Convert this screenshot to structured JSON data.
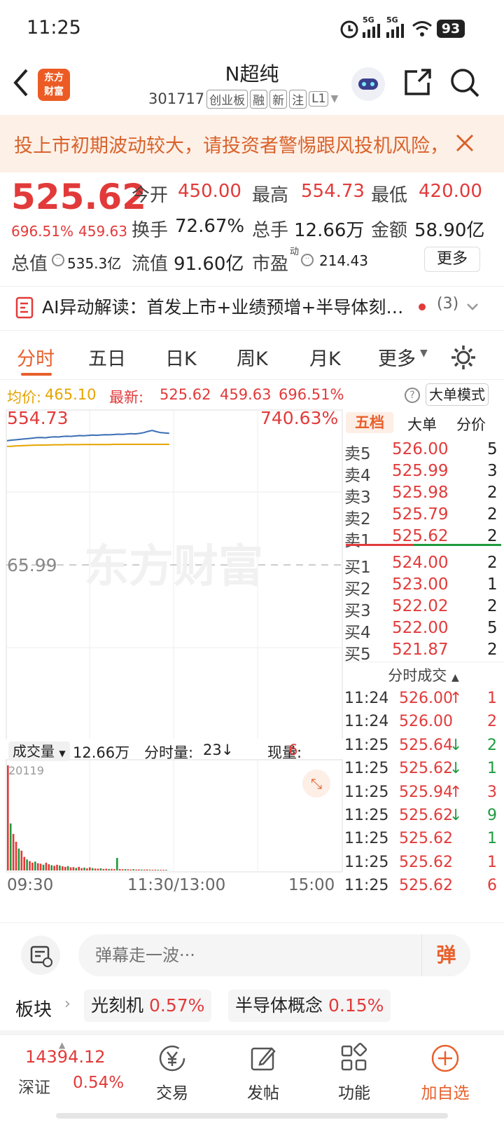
{
  "status": {
    "time": "11:25",
    "net1": "5G",
    "net2": "5G",
    "battery": "93"
  },
  "header": {
    "stock_name": "N超纯",
    "code": "301717",
    "tags": [
      "创业板",
      "融",
      "新",
      "注",
      "L1"
    ],
    "logo_line1": "东方",
    "logo_line2": "财富"
  },
  "warning": {
    "text": "投上市初期波动较大，请投资者警惕跟风投机风险，"
  },
  "quote": {
    "price": "525.62",
    "change_pct": "696.51%",
    "change": "459.63",
    "open_label": "今开",
    "open": "450.00",
    "high_label": "最高",
    "high": "554.73",
    "low_label": "最低",
    "low": "420.00",
    "turnover_label": "换手",
    "turnover": "72.67%",
    "volume_label": "总手",
    "volume": "12.66万",
    "amount_label": "金额",
    "amount": "58.90亿",
    "mcap_label": "总值",
    "mcap": "535.3亿",
    "float_label": "流值",
    "float": "91.60亿",
    "pe_label": "市盈",
    "pe_sup": "动",
    "pe": "214.43",
    "more_label": "更多"
  },
  "ai": {
    "text": "AI异动解读：首发上市+业绩预增+半导体刻…",
    "count": "(3)"
  },
  "tabs": [
    "分时",
    "五日",
    "日K",
    "周K",
    "月K",
    "更多"
  ],
  "pricebar": {
    "avg_label": "均价:",
    "avg": "465.10",
    "latest_label": "最新:",
    "latest": "525.62",
    "change": "459.63",
    "pct": "696.51%",
    "mode_label": "大单模式"
  },
  "chart_data": {
    "type": "line",
    "high_label": "554.73",
    "high_pct": "740.63%",
    "mid_label": "65.99",
    "watermark": "东方财富",
    "x_ticks": [
      "09:30",
      "11:30/13:00",
      "15:00"
    ],
    "price_series": [
      488,
      492,
      494,
      497,
      500,
      502,
      505,
      508,
      509,
      507,
      511,
      513,
      512,
      515,
      517,
      516,
      519,
      521,
      520,
      522,
      524,
      523,
      525,
      527,
      526,
      528,
      530,
      529,
      531,
      533,
      532,
      535,
      540,
      548,
      554,
      546,
      540,
      538,
      536
    ],
    "avg_series": [
      452,
      453,
      455,
      456,
      457,
      458,
      459,
      460,
      460,
      461,
      461,
      462,
      462,
      462,
      463,
      463,
      463,
      463,
      464,
      464,
      464,
      464,
      464,
      464,
      464,
      465,
      465,
      465,
      465,
      465,
      465,
      465,
      465,
      465,
      465,
      465,
      465,
      465,
      465
    ],
    "volume_label": "成交量",
    "volume_total": "12.66万",
    "minute_vol_label": "分时量:",
    "minute_vol": "23",
    "cur_vol_label": "现量:",
    "cur_vol": "6",
    "volume_max": "20119",
    "volume_bars": [
      20119,
      9000,
      7000,
      5500,
      4200,
      3800,
      2600,
      2100,
      1800,
      1500,
      1700,
      1400,
      1300,
      1100,
      1500,
      1200,
      1000,
      900,
      1100,
      950,
      800,
      700,
      850,
      600,
      650,
      500,
      700,
      450,
      550,
      400,
      600,
      450,
      380,
      350,
      420,
      300,
      330,
      280,
      310,
      260,
      2400,
      280,
      230,
      250,
      210,
      190,
      240,
      180,
      200,
      170,
      160,
      190,
      150,
      140,
      160,
      130,
      120,
      110,
      100
    ]
  },
  "orderbook": {
    "tabs": [
      "五档",
      "大单",
      "分价"
    ],
    "asks": [
      {
        "label": "卖5",
        "price": "526.00",
        "vol": "5"
      },
      {
        "label": "卖4",
        "price": "525.99",
        "vol": "3"
      },
      {
        "label": "卖3",
        "price": "525.98",
        "vol": "2"
      },
      {
        "label": "卖2",
        "price": "525.79",
        "vol": "2"
      },
      {
        "label": "卖1",
        "price": "525.62",
        "vol": "2"
      }
    ],
    "bids": [
      {
        "label": "买1",
        "price": "524.00",
        "vol": "2"
      },
      {
        "label": "买2",
        "price": "523.00",
        "vol": "1"
      },
      {
        "label": "买3",
        "price": "522.02",
        "vol": "2"
      },
      {
        "label": "买4",
        "price": "522.00",
        "vol": "5"
      },
      {
        "label": "买5",
        "price": "521.87",
        "vol": "2"
      }
    ],
    "ticks_title": "分时成交",
    "ticks": [
      {
        "time": "11:24",
        "price": "526.00",
        "dir": "↑",
        "vol": "1",
        "color": "red"
      },
      {
        "time": "11:24",
        "price": "526.00",
        "dir": "",
        "vol": "2",
        "color": "red"
      },
      {
        "time": "11:25",
        "price": "525.64",
        "dir": "↓",
        "vol": "2",
        "color": "green"
      },
      {
        "time": "11:25",
        "price": "525.62",
        "dir": "↓",
        "vol": "1",
        "color": "green"
      },
      {
        "time": "11:25",
        "price": "525.94",
        "dir": "↑",
        "vol": "3",
        "color": "red"
      },
      {
        "time": "11:25",
        "price": "525.62",
        "dir": "↓",
        "vol": "9",
        "color": "green"
      },
      {
        "time": "11:25",
        "price": "525.62",
        "dir": "",
        "vol": "1",
        "color": "green"
      },
      {
        "time": "11:25",
        "price": "525.62",
        "dir": "",
        "vol": "1",
        "color": "red"
      },
      {
        "time": "11:25",
        "price": "525.62",
        "dir": "",
        "vol": "6",
        "color": "red"
      }
    ]
  },
  "comment": {
    "placeholder": "弹幕走一波···",
    "send_label": "弹"
  },
  "sector": {
    "label": "板块",
    "items": [
      {
        "name": "光刻机",
        "pct": "0.57%"
      },
      {
        "name": "半导体概念",
        "pct": "0.15%"
      }
    ]
  },
  "bottomnav": {
    "index_value": "14394.12",
    "index_name": "深证",
    "index_pct": "0.54%",
    "items": [
      {
        "label": "交易",
        "icon": "yen-icon"
      },
      {
        "label": "发帖",
        "icon": "edit-icon"
      },
      {
        "label": "功能",
        "icon": "grid-icon"
      },
      {
        "label": "加自选",
        "icon": "plus-circle-icon"
      }
    ]
  },
  "colors": {
    "red": "#e23a3a",
    "green": "#1e9b3e",
    "orange": "#e8602c",
    "price_line": "#3a6fb5",
    "avg_line": "#e5a400"
  }
}
